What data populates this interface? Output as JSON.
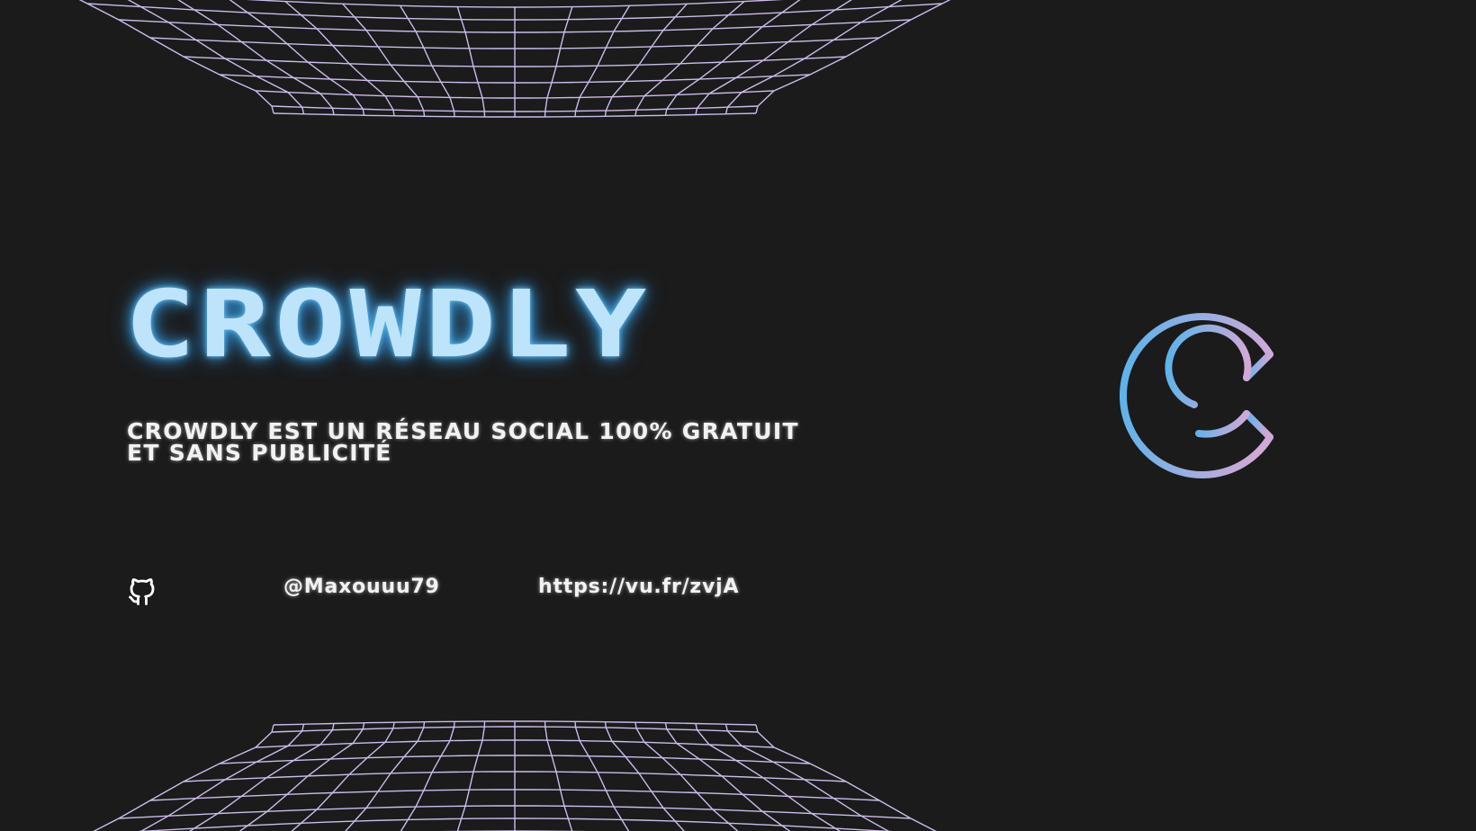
{
  "title": "CROWDLY",
  "tagline": "CROWDLY EST UN RÉSEAU SOCIAL 100% GRATUIT ET SANS PUBLICITÉ",
  "social": {
    "icon": "github-icon",
    "handle": "@Maxouuu79",
    "link": "https://vu.fr/zvjA"
  },
  "logo": {
    "icon": "crowdly-c-logo"
  },
  "colors": {
    "background": "#1b1b1b",
    "title": "#bde4fb",
    "title_glow": "#3d9bd8",
    "grid": "#cbbcec",
    "logo_gradient_start": "#56b4ec",
    "logo_gradient_end": "#cfa9d8",
    "text": "#f2f2f2"
  }
}
